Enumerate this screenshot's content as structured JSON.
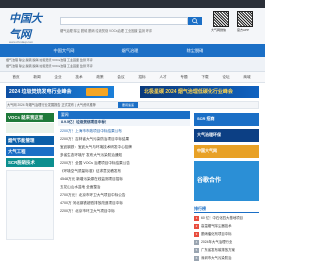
{
  "topbar": {
    "items": [
      "",
      "",
      "",
      "",
      ""
    ]
  },
  "header": {
    "logo": "中国大气网",
    "logo_sub": "www.chndaqi.com",
    "search_placeholder": "",
    "hotlinks": "烟气治理  除尘  脱硫  脱硝  垃圾焚烧  VOCs治理  工业固废  监测  环评",
    "qr_labels": [
      "大气网微信",
      "官方APP"
    ]
  },
  "nav": {
    "items": [
      "中国大气网",
      "烟气治理",
      "除尘脱硝"
    ]
  },
  "tabs": {
    "items": [
      "首页",
      "新闻",
      "企业",
      "技术",
      "政策",
      "会议",
      "招标",
      "人才",
      "专题",
      "下载",
      "论坛",
      "商城"
    ]
  },
  "banners": {
    "left": "2024 垃圾焚烧发电行业峰会",
    "right": "北极星碳 2024 烟气治理低碳化行业峰会"
  },
  "ticker": {
    "label": "要闻速递",
    "text": "大气网 2024 年烟气治理行业发展报告 正式发布  |  大气资讯推荐"
  },
  "left_banners": [
    {
      "label": "VOCs 就来我这里",
      "color": "#1f7a3a"
    },
    {
      "label": "烟气节能管理",
      "color": "#0b5ea8"
    },
    {
      "label": "大气工程",
      "color": "#1b6fc6"
    },
    {
      "label": "SCR脱硝技术",
      "color": "#0c8f8f"
    }
  ],
  "main": {
    "head": "要闻",
    "subhead": "8.9.5亿！垃圾焚烧项目中标！",
    "news": [
      "2200万！上海市市政项目中标结果公布",
      "2200万！吉林省大气污染防治项目中标结果",
      "宝武钢铁：宝武大气与环境技术研发中心挂牌",
      "多省生态环境厅 发布大气污染防治通知",
      "2200万！全国 VOCs 治理项目中标结果公告",
      "《环境空气质量标准》征求意见稿发布",
      "4548万元 新增污染源在线监测项目招标",
      "五花山山水盆地 全面整治",
      "2700万元！北京市环卫大气项目中标公告",
      "4700万 河北钢铁超低排放改造项目中标",
      "2200万！北京市环卫大气项目中标"
    ]
  },
  "right": {
    "banners": [
      {
        "label": "SCR 招商",
        "color": "#1b6fc6"
      },
      {
        "label": "大气治理环保",
        "color": "#0c3f84"
      },
      {
        "label": "中国大气网",
        "color": "#e8a126"
      },
      {
        "label": "谷歌合作",
        "color": "#2b8fd6"
      }
    ],
    "rank_title": "排行榜",
    "rank": [
      "60 亿！中石化四大基地项目",
      "高温烟气除尘器技术",
      "脱硝催化剂项目中标",
      "2024年大气治理行业",
      "广东省发布碳排放方案",
      "深圳市大气污染防治"
    ]
  }
}
